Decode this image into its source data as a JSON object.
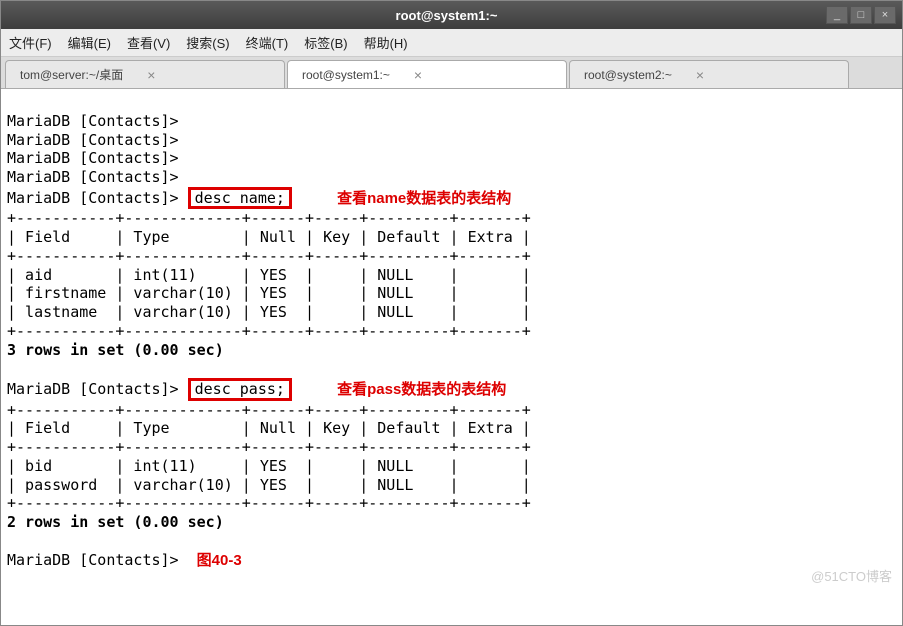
{
  "window": {
    "title": "root@system1:~",
    "min": "_",
    "max": "□",
    "close": "×"
  },
  "menu": {
    "file": "文件(F)",
    "edit": "编辑(E)",
    "view": "查看(V)",
    "search": "搜索(S)",
    "terminal": "终端(T)",
    "tabs": "标签(B)",
    "help": "帮助(H)"
  },
  "tabs": [
    {
      "label": "tom@server:~/桌面",
      "active": false
    },
    {
      "label": "root@system1:~",
      "active": true
    },
    {
      "label": "root@system2:~",
      "active": false
    }
  ],
  "term": {
    "prompt": "MariaDB [Contacts]>",
    "cmd1": "desc name;",
    "anno1": "查看name数据表的表结构",
    "border": "+-----------+-------------+------+-----+---------+-------+",
    "header": "| Field     | Type        | Null | Key | Default | Extra |",
    "t1r1": "| aid       | int(11)     | YES  |     | NULL    |       |",
    "t1r2": "| firstname | varchar(10) | YES  |     | NULL    |       |",
    "t1r3": "| lastname  | varchar(10) | YES  |     | NULL    |       |",
    "t1foot": "3 rows in set (0.00 sec)",
    "cmd2": "desc pass;",
    "anno2": "查看pass数据表的表结构",
    "t2r1": "| bid       | int(11)     | YES  |     | NULL    |       |",
    "t2r2": "| password  | varchar(10) | YES  |     | NULL    |       |",
    "t2foot": "2 rows in set (0.00 sec)",
    "fig": "图40-3",
    "watermark": "@51CTO博客"
  }
}
